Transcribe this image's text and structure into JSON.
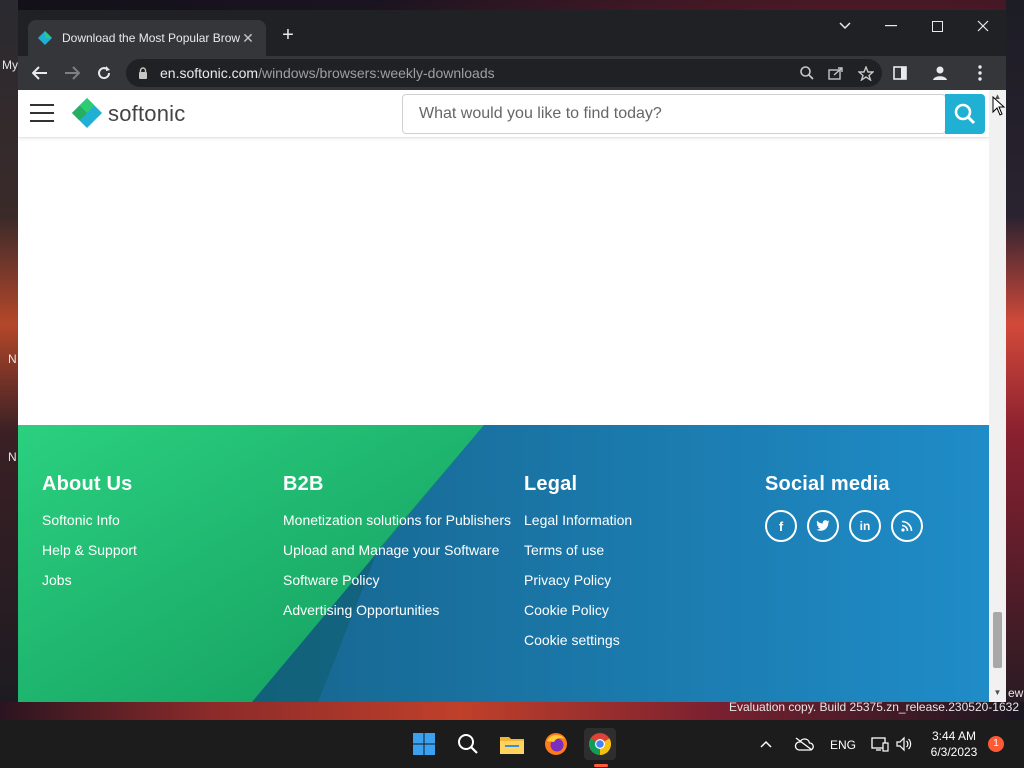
{
  "desktop": {
    "left_labels": [
      "My",
      "N",
      "N"
    ],
    "right_label": "ew",
    "eval_line": "Evaluation copy. Build 25375.zn_release.230520-1632"
  },
  "browser": {
    "tab_title": "Download the Most Popular Browsers",
    "new_tab": "+",
    "url_host": "en.softonic.com",
    "url_path": "/windows/browsers:weekly-downloads"
  },
  "site": {
    "logo_text": "softonic",
    "search_placeholder": "What would you like to find today?"
  },
  "footer": {
    "about": {
      "heading": "About Us",
      "links": [
        "Softonic Info",
        "Help & Support",
        "Jobs"
      ]
    },
    "b2b": {
      "heading": "B2B",
      "links": [
        "Monetization solutions for Publishers",
        "Upload and Manage your Software",
        "Software Policy",
        "Advertising Opportunities"
      ]
    },
    "legal": {
      "heading": "Legal",
      "links": [
        "Legal Information",
        "Terms of use",
        "Privacy Policy",
        "Cookie Policy",
        "Cookie settings"
      ]
    },
    "social": {
      "heading": "Social media",
      "icons": [
        "facebook-icon",
        "twitter-icon",
        "linkedin-icon",
        "rss-icon"
      ]
    }
  },
  "taskbar": {
    "language": "ENG",
    "time": "3:44 AM",
    "date": "6/3/2023",
    "notifications": "1"
  },
  "colors": {
    "search_button": "#1fb0d4",
    "footer_green": "#27c97a",
    "footer_blue": "#1f85c2"
  }
}
